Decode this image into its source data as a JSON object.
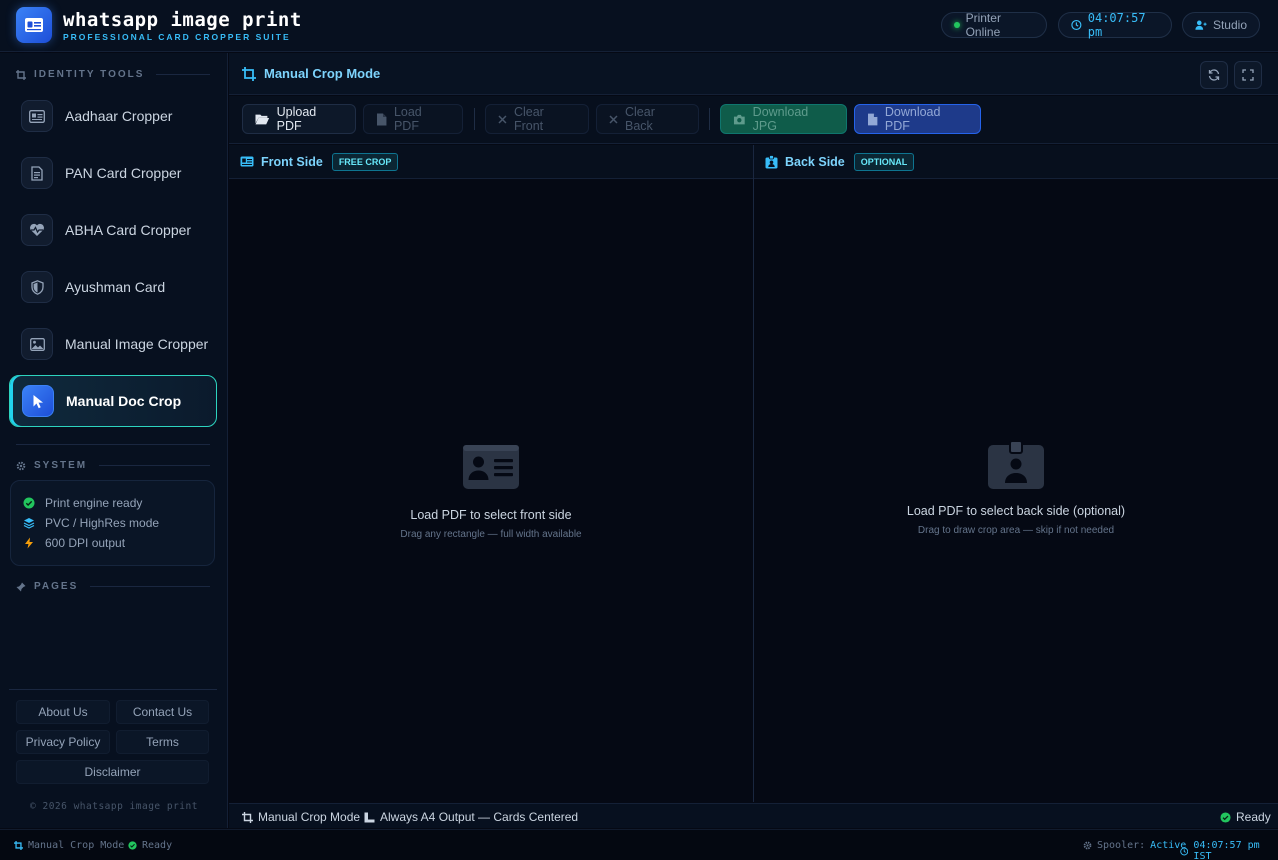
{
  "header": {
    "app_title": "whatsapp image print",
    "app_subtitle": "PROFESSIONAL CARD CROPPER SUITE",
    "printer_status": "Printer Online",
    "clock": "04:07:57 pm",
    "user_label": "Studio"
  },
  "sidebar": {
    "identity_heading": "IDENTITY TOOLS",
    "items": [
      {
        "label": "Aadhaar Cropper",
        "icon": "id-card-icon"
      },
      {
        "label": "PAN Card Cropper",
        "icon": "document-icon"
      },
      {
        "label": "ABHA Card Cropper",
        "icon": "heart-pulse-icon"
      },
      {
        "label": "Ayushman Card",
        "icon": "shield-icon"
      },
      {
        "label": "Manual Image Cropper",
        "icon": "image-icon"
      },
      {
        "label": "Manual Doc Crop",
        "icon": "cursor-icon",
        "active": true
      }
    ],
    "system_heading": "SYSTEM",
    "system_rows": [
      {
        "label": "Print engine ready",
        "icon": "check-circle-icon"
      },
      {
        "label": "PVC / HighRes mode",
        "icon": "layers-icon"
      },
      {
        "label": "600 DPI output",
        "icon": "bolt-icon"
      }
    ],
    "pages_heading": "PAGES",
    "footer_links": [
      "About Us",
      "Contact Us",
      "Privacy Policy",
      "Terms",
      "Disclaimer"
    ],
    "copyright": "© 2026 whatsapp image print"
  },
  "main": {
    "mode_title": "Manual Crop Mode",
    "toolbar": {
      "upload": "Upload PDF",
      "load": "Load PDF",
      "clear_front": "Clear Front",
      "clear_back": "Clear Back",
      "download_jpg": "Download JPG",
      "download_pdf": "Download PDF"
    },
    "front": {
      "title": "Front Side",
      "badge": "FREE CROP",
      "message": "Load PDF to select front side",
      "hint": "Drag any rectangle — full width available"
    },
    "back": {
      "title": "Back Side",
      "badge": "OPTIONAL",
      "message": "Load PDF to select back side (optional)",
      "hint": "Drag to draw crop area — skip if not needed"
    },
    "statusbar": {
      "mode": "Manual Crop Mode",
      "output": "Always A4 Output — Cards Centered",
      "state": "Ready"
    }
  },
  "footer": {
    "mode": "Manual Crop Mode",
    "state": "Ready",
    "spooler_label": "Spooler:",
    "spooler_value": "Active",
    "time": "04:07:57 pm IST"
  },
  "colors": {
    "accent": "#38bdf8",
    "success": "#22c55e",
    "brand": "#3b82f6",
    "background": "#050914"
  }
}
